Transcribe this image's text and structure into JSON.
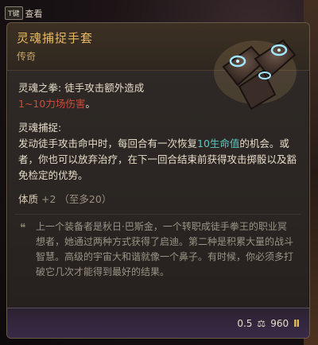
{
  "key_hint": {
    "key": "T键",
    "label": "查看"
  },
  "item": {
    "name": "灵魂捕捉手套",
    "rarity": "传奇",
    "ability1_title": "灵魂之拳",
    "ability1_text": ": 徒手攻击额外造成",
    "ability1_damage": "1~10力场伤害",
    "ability1_end": "。",
    "ability2_title": "灵魂捕捉:",
    "ability2_line1a": "发动徒手攻击命中时，每回合有一次恢复",
    "ability2_heal": "10生命值",
    "ability2_line2": "的机会。或者，你也可以放弃治疗，在下一回合结束前获得攻击掷骰以及豁免检定的优势。",
    "stat_label": "体质",
    "stat_value": "+2",
    "stat_note": "（至多20）",
    "lore": "上一个装备者是秋日·巴斯金，一个转职成徒手拳王的职业冥想者，她通过两种方式获得了启迪。第二种是积累大量的战斗智慧。高级的宇宙大和谐就像一个鼻子。有时候，你必须多打破它几次才能得到最好的结果。"
  },
  "footer": {
    "weight": "0.5",
    "weight_icon": "weight-icon",
    "price": "960",
    "price_icon": "coin-icon"
  },
  "colors": {
    "name": "#e8b864",
    "damage": "#d04a3a",
    "heal": "#5fc8c0"
  }
}
